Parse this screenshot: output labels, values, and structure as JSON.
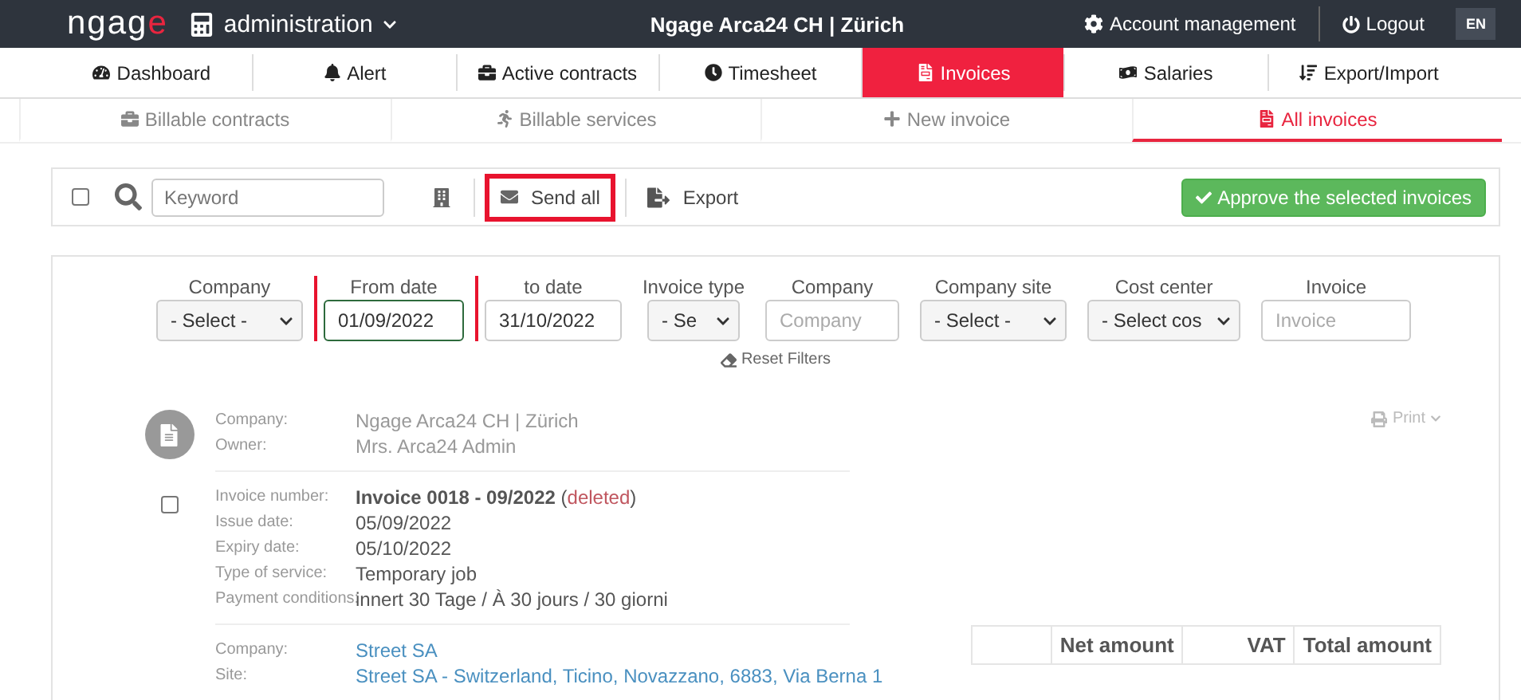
{
  "header": {
    "logo_text": "ngag",
    "logo_accent": "e",
    "module": "administration",
    "title": "Ngage Arca24 CH | Zürich",
    "account": "Account management",
    "logout": "Logout",
    "language": "EN"
  },
  "main_tabs": [
    {
      "label": "Dashboard",
      "selected": false
    },
    {
      "label": "Alert",
      "selected": false
    },
    {
      "label": "Active contracts",
      "selected": false
    },
    {
      "label": "Timesheet",
      "selected": false
    },
    {
      "label": "Invoices",
      "selected": true
    },
    {
      "label": "Salaries",
      "selected": false
    },
    {
      "label": "Export/Import",
      "selected": false
    }
  ],
  "sub_tabs": [
    {
      "label": "Billable contracts",
      "selected": false
    },
    {
      "label": "Billable services",
      "selected": false
    },
    {
      "label": "New invoice",
      "selected": false
    },
    {
      "label": "All invoices",
      "selected": true
    }
  ],
  "toolbar": {
    "select_all": false,
    "keyword_placeholder": "Keyword",
    "send_all": "Send all",
    "export": "Export",
    "approve": "Approve the selected invoices"
  },
  "filters": [
    {
      "label": "Company",
      "kind": "select",
      "value": "- Select -",
      "marked": false
    },
    {
      "label": "From date",
      "kind": "date",
      "value": "01/09/2022",
      "marked": true
    },
    {
      "label": "to date",
      "kind": "date",
      "value": "31/10/2022",
      "marked": true
    },
    {
      "label": "Invoice type",
      "kind": "select",
      "value": "- Se",
      "marked": false
    },
    {
      "label": "Company",
      "kind": "text",
      "placeholder": "Company",
      "marked": false
    },
    {
      "label": "Company site",
      "kind": "select",
      "value": "- Select -",
      "marked": false
    },
    {
      "label": "Cost center",
      "kind": "select",
      "value": "- Select cos",
      "marked": false
    },
    {
      "label": "Invoice",
      "kind": "text",
      "placeholder": "Invoice",
      "marked": false
    }
  ],
  "reset_filters": "Reset Filters",
  "invoice": {
    "checked": false,
    "print": "Print",
    "owner_block": [
      {
        "label": "Company:",
        "value": "Ngage Arca24 CH | Zürich"
      },
      {
        "label": "Owner:",
        "value": "Mrs. Arca24 Admin"
      }
    ],
    "number_label": "Invoice number:",
    "number": "Invoice 0018 - 09/2022",
    "status_open": "(",
    "status": "deleted",
    "status_close": ")",
    "details": [
      {
        "label": "Issue date:",
        "value": "05/09/2022"
      },
      {
        "label": "Expiry date:",
        "value": "05/10/2022"
      },
      {
        "label": "Type of service:",
        "value": "Temporary job"
      },
      {
        "label": "Payment conditions:",
        "value": "innert 30 Tage / À 30 jours / 30 giorni"
      }
    ],
    "client_block": [
      {
        "label": "Company:",
        "value": "Street SA"
      },
      {
        "label": "Site:",
        "value": "Street SA - Switzerland, Ticino, Novazzano, 6883, Via Berna 1"
      }
    ],
    "totals_columns": [
      "Net amount",
      "VAT",
      "Total amount"
    ]
  }
}
